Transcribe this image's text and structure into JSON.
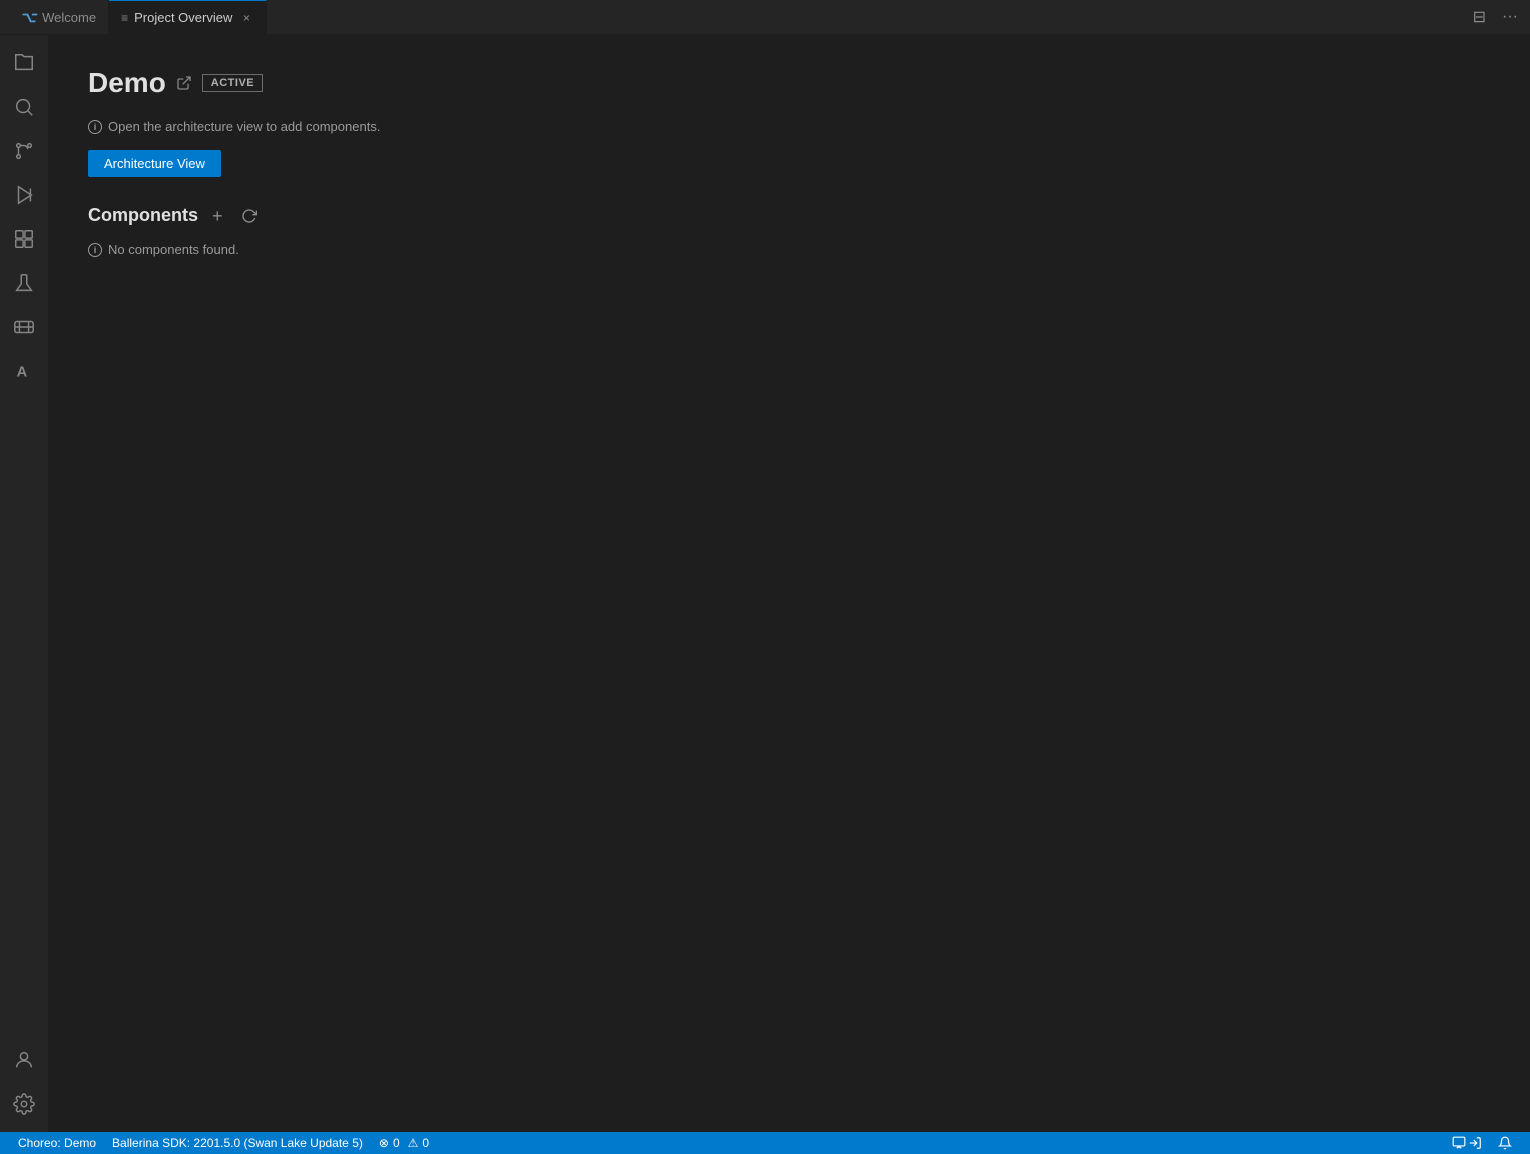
{
  "titlebar": {
    "tab_welcome_label": "Welcome",
    "tab_welcome_icon": "≋",
    "tab_project_icon": "≋",
    "tab_project_label": "Project Overview",
    "tab_close_label": "×",
    "split_editor_label": "⊟",
    "more_actions_label": "···"
  },
  "activity_bar": {
    "items": [
      {
        "id": "explorer",
        "icon": "files",
        "tooltip": "Explorer"
      },
      {
        "id": "search",
        "icon": "search",
        "tooltip": "Search"
      },
      {
        "id": "source-control",
        "icon": "source-control",
        "tooltip": "Source Control"
      },
      {
        "id": "run",
        "icon": "run",
        "tooltip": "Run and Debug"
      },
      {
        "id": "extensions",
        "icon": "extensions",
        "tooltip": "Extensions"
      },
      {
        "id": "testing",
        "icon": "testing",
        "tooltip": "Testing"
      },
      {
        "id": "container",
        "icon": "container",
        "tooltip": "Container"
      },
      {
        "id": "font",
        "icon": "font",
        "tooltip": "Font"
      }
    ],
    "bottom_items": [
      {
        "id": "account",
        "icon": "account",
        "tooltip": "Accounts"
      },
      {
        "id": "settings",
        "icon": "settings",
        "tooltip": "Manage"
      }
    ]
  },
  "main": {
    "project_name": "Demo",
    "active_badge": "ACTIVE",
    "info_text": "Open the architecture view to add components.",
    "arch_view_button": "Architecture View",
    "components_section_title": "Components",
    "add_button_label": "+",
    "refresh_button_label": "↺",
    "no_components_text": "No components found."
  },
  "statusbar": {
    "choreo_label": "Choreo: Demo",
    "sdk_label": "Ballerina SDK: 2201.5.0 (Swan Lake Update 5)",
    "errors_count": "0",
    "warnings_count": "0",
    "error_icon": "⊗",
    "warning_icon": "⚠"
  },
  "colors": {
    "accent": "#007acc",
    "active_badge_border": "#6c6c6c",
    "bg_primary": "#1e1e1e",
    "bg_secondary": "#252526",
    "text_primary": "#cccccc",
    "text_muted": "#858585"
  }
}
